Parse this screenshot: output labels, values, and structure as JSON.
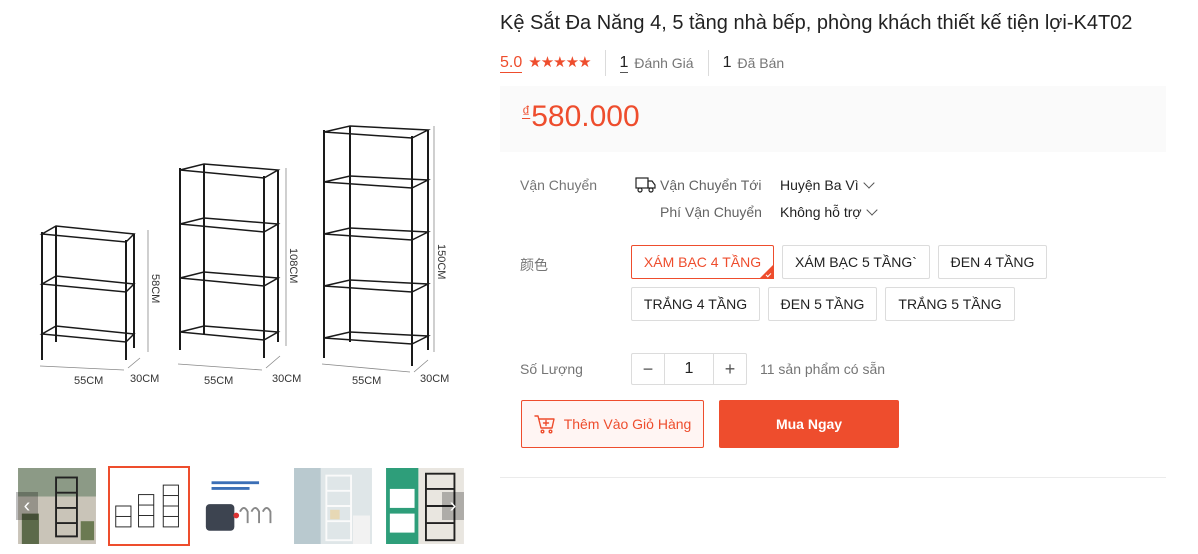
{
  "product": {
    "title": "Kệ Sắt Đa Năng 4, 5 tầng nhà bếp, phòng khách thiết kế tiện lợi-K4T02",
    "rating_score": "5.0",
    "stars": 5,
    "reviews_count": "1",
    "reviews_label": "Đánh Giá",
    "sold_count": "1",
    "sold_label": "Đã Bán",
    "currency": "₫",
    "price": "580.000"
  },
  "gallery": {
    "main_image_labels": {
      "short_height": "58CM",
      "mid_height": "108CM",
      "tall_height": "150CM",
      "width": "55CM",
      "depth": "30CM"
    },
    "thumbnail_count": 5,
    "active_thumbnail": 1
  },
  "shipping": {
    "label": "Vận Chuyển",
    "to_label": "Vận Chuyển Tới",
    "to_value": "Huyện Ba Vì",
    "fee_label": "Phí Vận Chuyển",
    "fee_value": "Không hỗ trợ"
  },
  "variants": {
    "label": "颜色",
    "options": [
      "XÁM BẠC 4 TẦNG",
      "XÁM BẠC 5 TẦNG`",
      "ĐEN 4 TẦNG",
      "TRẮNG 4 TẦNG",
      "ĐEN 5 TẦNG",
      "TRẮNG 5 TẦNG"
    ],
    "selected": "XÁM BẠC 4 TẦNG"
  },
  "quantity": {
    "label": "Số Lượng",
    "value": "1",
    "minus": "−",
    "plus": "+",
    "stock_text": "11 sản phẩm có sẵn"
  },
  "actions": {
    "add_to_cart": "Thêm Vào Giỏ Hàng",
    "buy_now": "Mua Ngay"
  },
  "colors": {
    "accent": "#ee4d2d",
    "price_bg": "#fafafa"
  },
  "icons": {
    "star": "star-icon",
    "truck": "truck-icon",
    "cart": "cart-plus-icon",
    "chevron": "chevron-down-icon",
    "prev": "chevron-left-icon",
    "next": "chevron-right-icon"
  }
}
